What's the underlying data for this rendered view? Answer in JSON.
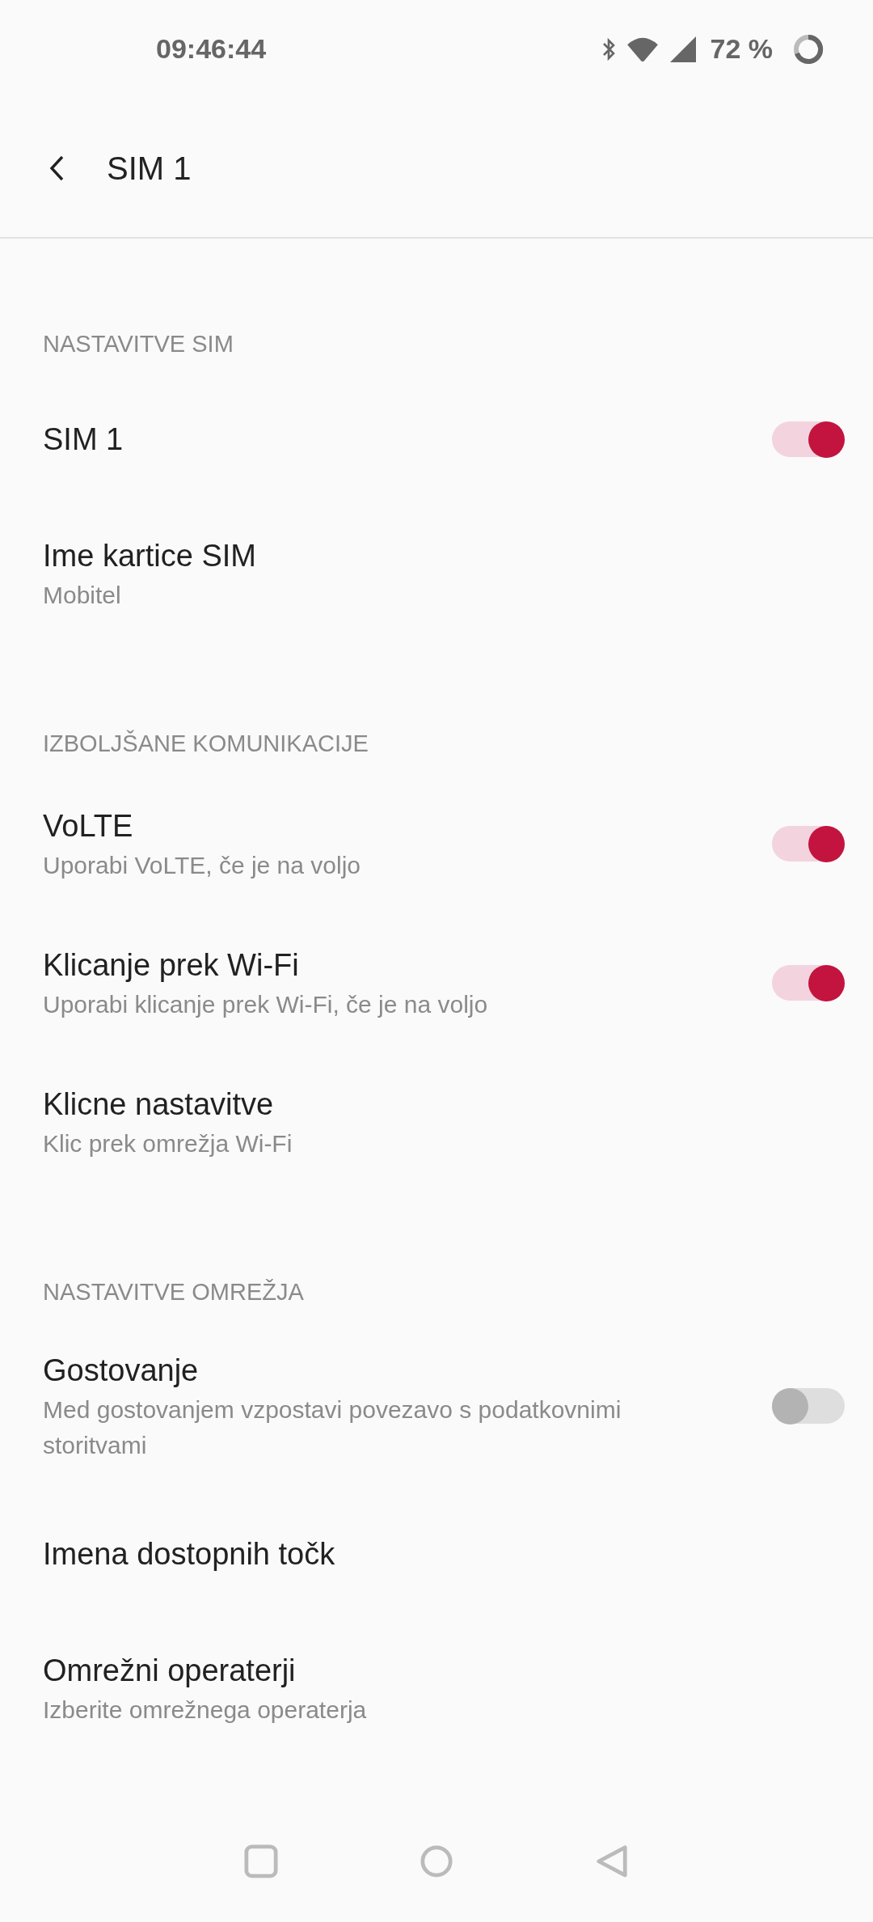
{
  "status_bar": {
    "time": "09:46:44",
    "battery": "72 %"
  },
  "app_bar": {
    "title": "SIM 1"
  },
  "sections": [
    {
      "title": "NASTAVITVE SIM",
      "items": [
        {
          "kind": "switch",
          "title": "SIM 1",
          "on": true
        },
        {
          "kind": "text",
          "title": "Ime kartice SIM",
          "summary": "Mobitel"
        }
      ]
    },
    {
      "title": "IZBOLJŠANE KOMUNIKACIJE",
      "items": [
        {
          "kind": "switch",
          "title": "VoLTE",
          "summary": "Uporabi VoLTE, če je na voljo",
          "on": true
        },
        {
          "kind": "switch",
          "title": "Klicanje prek Wi-Fi",
          "summary": "Uporabi klicanje prek Wi-Fi, če je na voljo",
          "on": true
        },
        {
          "kind": "text",
          "title": "Klicne nastavitve",
          "summary": "Klic prek omrežja Wi-Fi"
        }
      ]
    },
    {
      "title": "NASTAVITVE OMREŽJA",
      "items": [
        {
          "kind": "switch",
          "title": "Gostovanje",
          "summary": "Med gostovanjem vzpostavi povezavo s podatkovnimi storitvami",
          "on": false
        },
        {
          "kind": "text",
          "title": "Imena dostopnih točk"
        },
        {
          "kind": "text",
          "title": "Omrežni operaterji",
          "summary": "Izberite omrežnega operaterja"
        }
      ]
    }
  ]
}
